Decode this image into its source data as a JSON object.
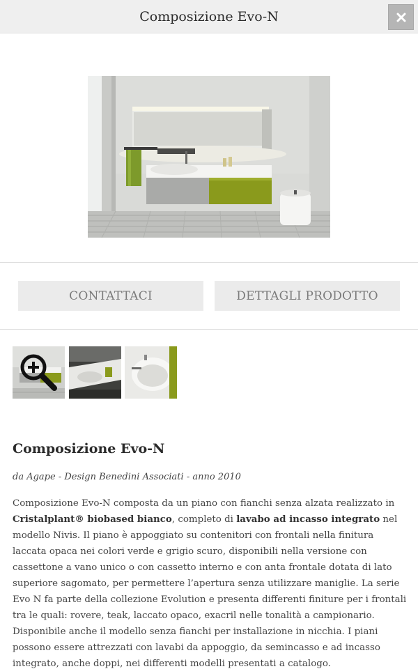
{
  "header": {
    "title": "Composizione Evo-N",
    "close_icon": "close-icon"
  },
  "hero": {
    "image_alt": "Composizione Evo-N bathroom vanity"
  },
  "actions": {
    "contact_label": "CONTATTACI",
    "details_label": "DETTAGLI PRODOTTO"
  },
  "thumbnails": [
    {
      "name": "thumbnail-1",
      "overlay_icon": "zoom-in-icon"
    },
    {
      "name": "thumbnail-2"
    },
    {
      "name": "thumbnail-3"
    }
  ],
  "product": {
    "title": "Composizione Evo-N",
    "byline": "da Agape - Design Benedini Associati - anno 2010",
    "desc_part1": "Composizione Evo-N composta da un piano con fianchi senza alzata realizzato in ",
    "desc_bold1": "Cristalplant® biobased bianco",
    "desc_part2": ", completo di ",
    "desc_bold2": "lavabo ad incasso integrato",
    "desc_part3": " nel modello Nivis. Il piano è appoggiato su contenitori con frontali nella finitura laccata opaca nei colori verde e grigio scuro, disponibili nella versione con cassettone a vano unico o con cassetto interno e con anta frontale dotata di lato superiore sagomato, per permettere l’apertura senza utilizzare maniglie. La serie Evo N fa parte della collezione Evolution e presenta differenti finiture per i frontali tra le quali: rovere, teak, laccato opaco, exacril nelle tonalità a campionario. Disponibile anche il modello senza fianchi per installazione in nicchia. I piani possono essere attrezzati con lavabi da appoggio, da semincasso e ad incasso integrato, anche doppi, nei differenti modelli presentati a catalogo."
  },
  "colors": {
    "header_bg": "#efefef",
    "button_bg": "#ebebeb",
    "vanity_green": "#8a9a1c",
    "vanity_gray": "#a9aaa8"
  }
}
